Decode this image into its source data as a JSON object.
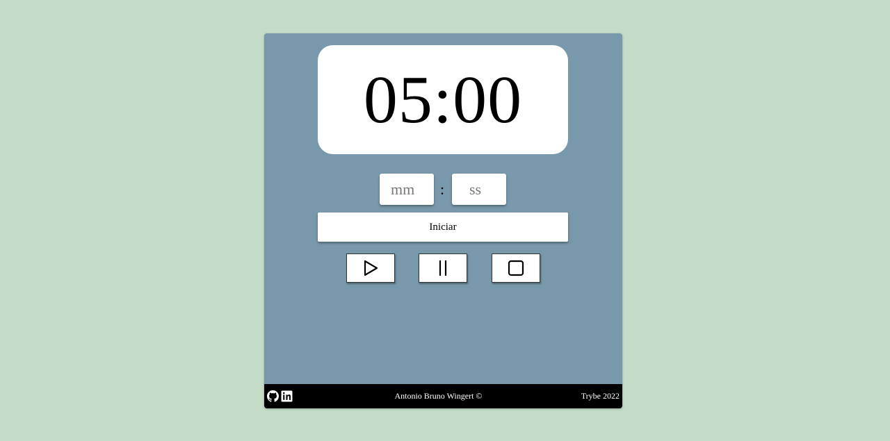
{
  "timer": {
    "display": "05:00"
  },
  "inputs": {
    "minutes_placeholder": "mm",
    "minutes_value": "",
    "seconds_placeholder": "ss",
    "seconds_value": "",
    "separator": ":"
  },
  "start_button": {
    "label": "Iniciar"
  },
  "controls": {
    "play_icon": "play-icon",
    "pause_icon": "pause-icon",
    "stop_icon": "stop-icon"
  },
  "footer": {
    "author": "Antonio Bruno Wingert ©",
    "brand": "Trybe 2022",
    "icons": [
      "github-icon",
      "linkedin-icon"
    ]
  },
  "colors": {
    "background": "#c4dcc7",
    "card": "#7898ab",
    "footer": "#000000"
  }
}
